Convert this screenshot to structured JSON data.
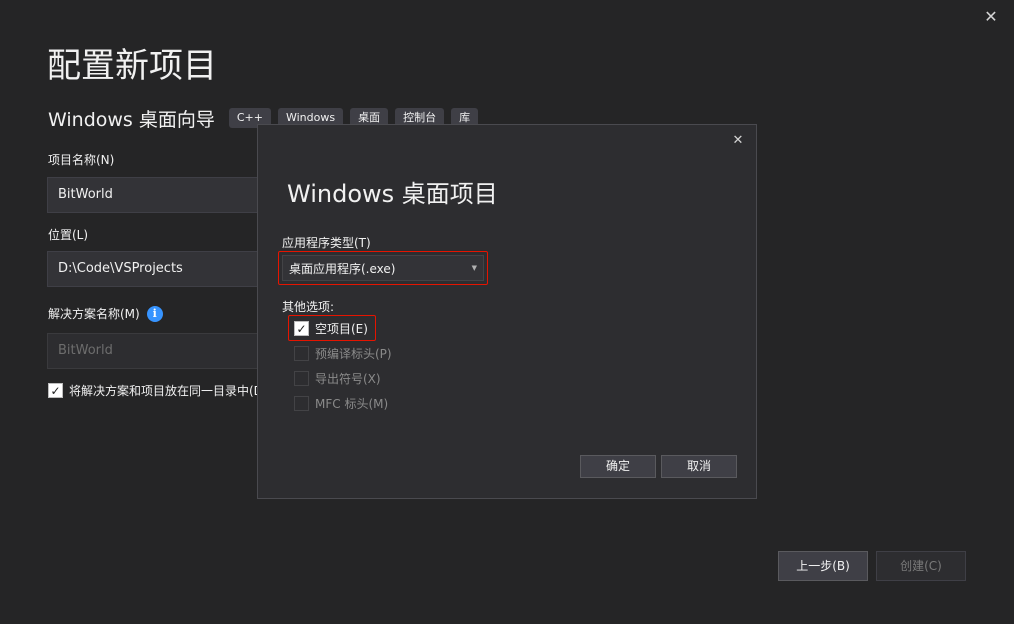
{
  "window": {
    "close_glyph": "✕"
  },
  "page": {
    "title": "配置新项目",
    "template_name": "Windows 桌面向导",
    "tags": [
      "C++",
      "Windows",
      "桌面",
      "控制台",
      "库"
    ]
  },
  "form": {
    "project_name_label": "项目名称(N)",
    "project_name_value": "BitWorld",
    "location_label": "位置(L)",
    "location_value": "D:\\Code\\VSProjects",
    "solution_name_label": "解决方案名称(M)",
    "solution_name_value": "BitWorld",
    "info_glyph": "i",
    "same_dir_label": "将解决方案和项目放在同一目录中(D",
    "same_dir_checked": true
  },
  "footer": {
    "prev_label": "上一步(B)",
    "create_label": "创建(C)"
  },
  "dialog": {
    "close_glyph": "✕",
    "title": "Windows 桌面项目",
    "app_type_label": "应用程序类型(T)",
    "app_type_value": "桌面应用程序(.exe)",
    "other_options_label": "其他选项:",
    "options": [
      {
        "label": "空项目(E)",
        "checked": true,
        "enabled": true
      },
      {
        "label": "预编译标头(P)",
        "checked": false,
        "enabled": false
      },
      {
        "label": "导出符号(X)",
        "checked": false,
        "enabled": false
      },
      {
        "label": "MFC 标头(M)",
        "checked": false,
        "enabled": false
      }
    ],
    "ok_label": "确定",
    "cancel_label": "取消"
  },
  "icons": {
    "close": "close-icon",
    "info": "info-icon",
    "dropdown": "chevron-down-icon",
    "check": "checkmark-icon"
  },
  "colors": {
    "background": "#252526",
    "dialog_background": "#2d2d30",
    "highlight_red": "#e51400",
    "info_blue": "#3794ff"
  }
}
